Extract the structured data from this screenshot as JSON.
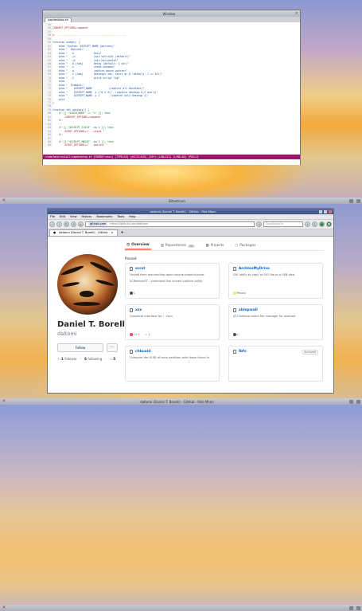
{
  "desktop1": {
    "terminal": {
      "title": "Window",
      "tab": "capdesktop.sh",
      "lines": [
        {
          "n": "55",
          "t": "",
          "c": ""
        },
        {
          "n": "56",
          "t": "CONVERT_OPTIONS+=append",
          "c": "red"
        },
        {
          "n": "57",
          "t": "",
          "c": ""
        },
        {
          "n": "58",
          "t": "#-----------------------------------------------",
          "c": "cmt"
        },
        {
          "n": "59",
          "t": "",
          "c": ""
        },
        {
          "n": "60",
          "t": "function usage() {",
          "c": ""
        },
        {
          "n": "61",
          "t": "    echo \"Syntax: $SCRIPT_NAME [options]\"",
          "c": ""
        },
        {
          "n": "62",
          "t": "    echo \"  Options:\"",
          "c": ""
        },
        {
          "n": "63",
          "t": "    echo \"  -h             help\"",
          "c": ""
        },
        {
          "n": "64",
          "t": "    echo \"  -jv            join vertical (default)\"",
          "c": ""
        },
        {
          "n": "65",
          "t": "    echo \"  -jh            join horizontal\"",
          "c": ""
        },
        {
          "n": "66",
          "t": "    echo \"  -d [num]       delay (default: 1 sec)\"",
          "c": ""
        },
        {
          "n": "67",
          "t": "    echo \"  -s             stack windows\"",
          "c": ""
        },
        {
          "n": "68",
          "t": "    echo \"  -p             capture mouse pointer\"",
          "c": ""
        },
        {
          "n": "69",
          "t": "    echo \"  -i [num]       desktops ids, start at 0 (default -1 == all)\"",
          "c": ""
        },
        {
          "n": "70",
          "t": "    echo \"  -C             print script log\"",
          "c": ""
        },
        {
          "n": "71",
          "t": "    echo",
          "c": ""
        },
        {
          "n": "72",
          "t": "    echo \"  Example:\"",
          "c": ""
        },
        {
          "n": "73",
          "t": "    echo \"    $SCRIPT_NAME           (capture all desktops)\"",
          "c": ""
        },
        {
          "n": "74",
          "t": "    echo \"    $SCRIPT_NAME -i \\\"0 2 4\\\"  (capture desktop 0,2 and 4)\"",
          "c": ""
        },
        {
          "n": "75",
          "t": "    echo \"    $SCRIPT_NAME -i 1       (capture only desktop 1)\"",
          "c": ""
        },
        {
          "n": "76",
          "t": "    exit",
          "c": ""
        },
        {
          "n": "77",
          "t": "}",
          "c": ""
        },
        {
          "n": "78",
          "t": "",
          "c": ""
        },
        {
          "n": "79",
          "t": "function set_options() {",
          "c": ""
        },
        {
          "n": "80",
          "t": "    if [[ \"$JOIN_MODE\" == \"h\" ]]; then",
          "c": "grn"
        },
        {
          "n": "81",
          "t": "        CONVERT_OPTIONS+=append",
          "c": "red"
        },
        {
          "n": "82",
          "t": "    fi",
          "c": "grn"
        },
        {
          "n": "83",
          "t": "",
          "c": ""
        },
        {
          "n": "84",
          "t": "    if [[ \"$SCRIPT_STACK\" -eq 1 ]]; then",
          "c": "grn"
        },
        {
          "n": "85",
          "t": "        SCROT_OPTIONS+=\" --stack \"",
          "c": "red"
        },
        {
          "n": "86",
          "t": "    fi",
          "c": "grn"
        },
        {
          "n": "87",
          "t": "",
          "c": ""
        },
        {
          "n": "88",
          "t": "    if [[ \"$SCRIPT_MOUSE\" -eq 1 ]]; then",
          "c": "grn"
        },
        {
          "n": "89",
          "t": "        SCROT_OPTIONS+=\" --pointer \"",
          "c": "red"
        }
      ],
      "status": "/code/bashinstall/capdesktop.sh [FORMAT=unix] [TYPE=SH] [ASCII=035] [26%] [LEN=223] [LINE=64] [POS=1]"
    },
    "taskbar_title": "Bitvetrivm"
  },
  "desktop2": {
    "taskbar_title": "daltomi (Daniel T. Borelli) · GitHub - Pale Moon",
    "browser": {
      "title": "daltomi (Daniel T. Borelli) · GitHub - Pale Moon",
      "menu": [
        "File",
        "Edit",
        "View",
        "History",
        "Bookmarks",
        "Tools",
        "Help"
      ],
      "url_host": "github.com",
      "url_full": "https://github.com/daltomi",
      "search_placeholder": "DuckDuckGo",
      "tab_label": "daltomi (Daniel T. Borelli) · GitHub",
      "tab_close": "×",
      "new_tab": "+",
      "profile": {
        "name": "Daniel T. Borelli",
        "username": "daltomi",
        "follow": "Follow",
        "more": "···",
        "followers_count": "1",
        "followers_label": "follower",
        "following_count": "6",
        "following_label": "following",
        "stars": "5"
      },
      "tabs": [
        {
          "label": "Overview",
          "count": ""
        },
        {
          "label": "Repositories",
          "count": "28"
        },
        {
          "label": "Projects",
          "count": ""
        },
        {
          "label": "Packages",
          "count": ""
        }
      ],
      "pinned_label": "Pinned",
      "repos": [
        {
          "name": "scrot",
          "desc": "Forked from resurrecting-open-source-projects/scrot",
          "desc2": "SCReenshOT - command line screen capture utility",
          "lang": "C",
          "color": "#555555",
          "stars": "",
          "archived": ""
        },
        {
          "name": "ArchIsoMyDrive",
          "desc": "GUI utility to copy an ISO file to a USB disk.",
          "desc2": "",
          "lang": "Pascal",
          "color": "#E3F171",
          "stars": "",
          "archived": ""
        },
        {
          "name": "xsv",
          "desc": "Graphical interface for i · rsvn",
          "desc2": "",
          "lang": "C++",
          "color": "#f34b7d",
          "stars": "1",
          "archived": ""
        },
        {
          "name": "xbmpwall",
          "desc": "X11 bitmap colors file manager for xsetroot",
          "desc2": "",
          "lang": "C",
          "color": "#555555",
          "stars": "",
          "archived": ""
        },
        {
          "name": "chkuuid",
          "desc": "Compare the UUID of each partition with those found in",
          "desc2": "",
          "lang": "",
          "color": "",
          "stars": "",
          "archived": ""
        },
        {
          "name": "fbfs",
          "desc": "",
          "desc2": "",
          "lang": "",
          "color": "",
          "stars": "",
          "archived": "Archived"
        }
      ]
    }
  },
  "desktop3": {
    "taskbar_title": "daltomi (Daniel T. Borelli) · GitHub - Pale Moon"
  }
}
